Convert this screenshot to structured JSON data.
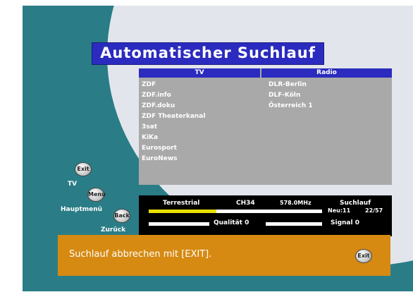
{
  "title": "Automatischer Suchlauf",
  "columns": {
    "tv": "TV",
    "radio": "Radio"
  },
  "tv_channels": [
    "ZDF",
    "ZDF.info",
    "ZDF.doku",
    "ZDF Theaterkanal",
    "3sat",
    "KiKa",
    "Eurosport",
    "EuroNews"
  ],
  "radio_channels": [
    "DLR-Berlin",
    "DLF-Köln",
    "Österreich 1"
  ],
  "nav": {
    "exit": {
      "icon": "Exit",
      "label": "TV"
    },
    "menu": {
      "icon": "Menu",
      "label": "Hauptmenü"
    },
    "back": {
      "icon": "Back",
      "label": "Zurück"
    }
  },
  "status": {
    "source": "Terrestrial",
    "channel": "CH34",
    "frequency": "578.0MHz",
    "mode": "Suchlauf",
    "new_count": "Neu:11",
    "progress_text": "22/57",
    "progress_fraction": 0.39,
    "quality_label": "Qualität 0",
    "signal_label": "Signal 0"
  },
  "message": {
    "text": "Suchlauf abbrechen mit [EXIT].",
    "exit_icon": "Exit"
  },
  "colors": {
    "background": "#2a7d86",
    "title_bar": "#2b2bbf",
    "message_bar": "#d68a12",
    "progress": "#e8e000"
  }
}
